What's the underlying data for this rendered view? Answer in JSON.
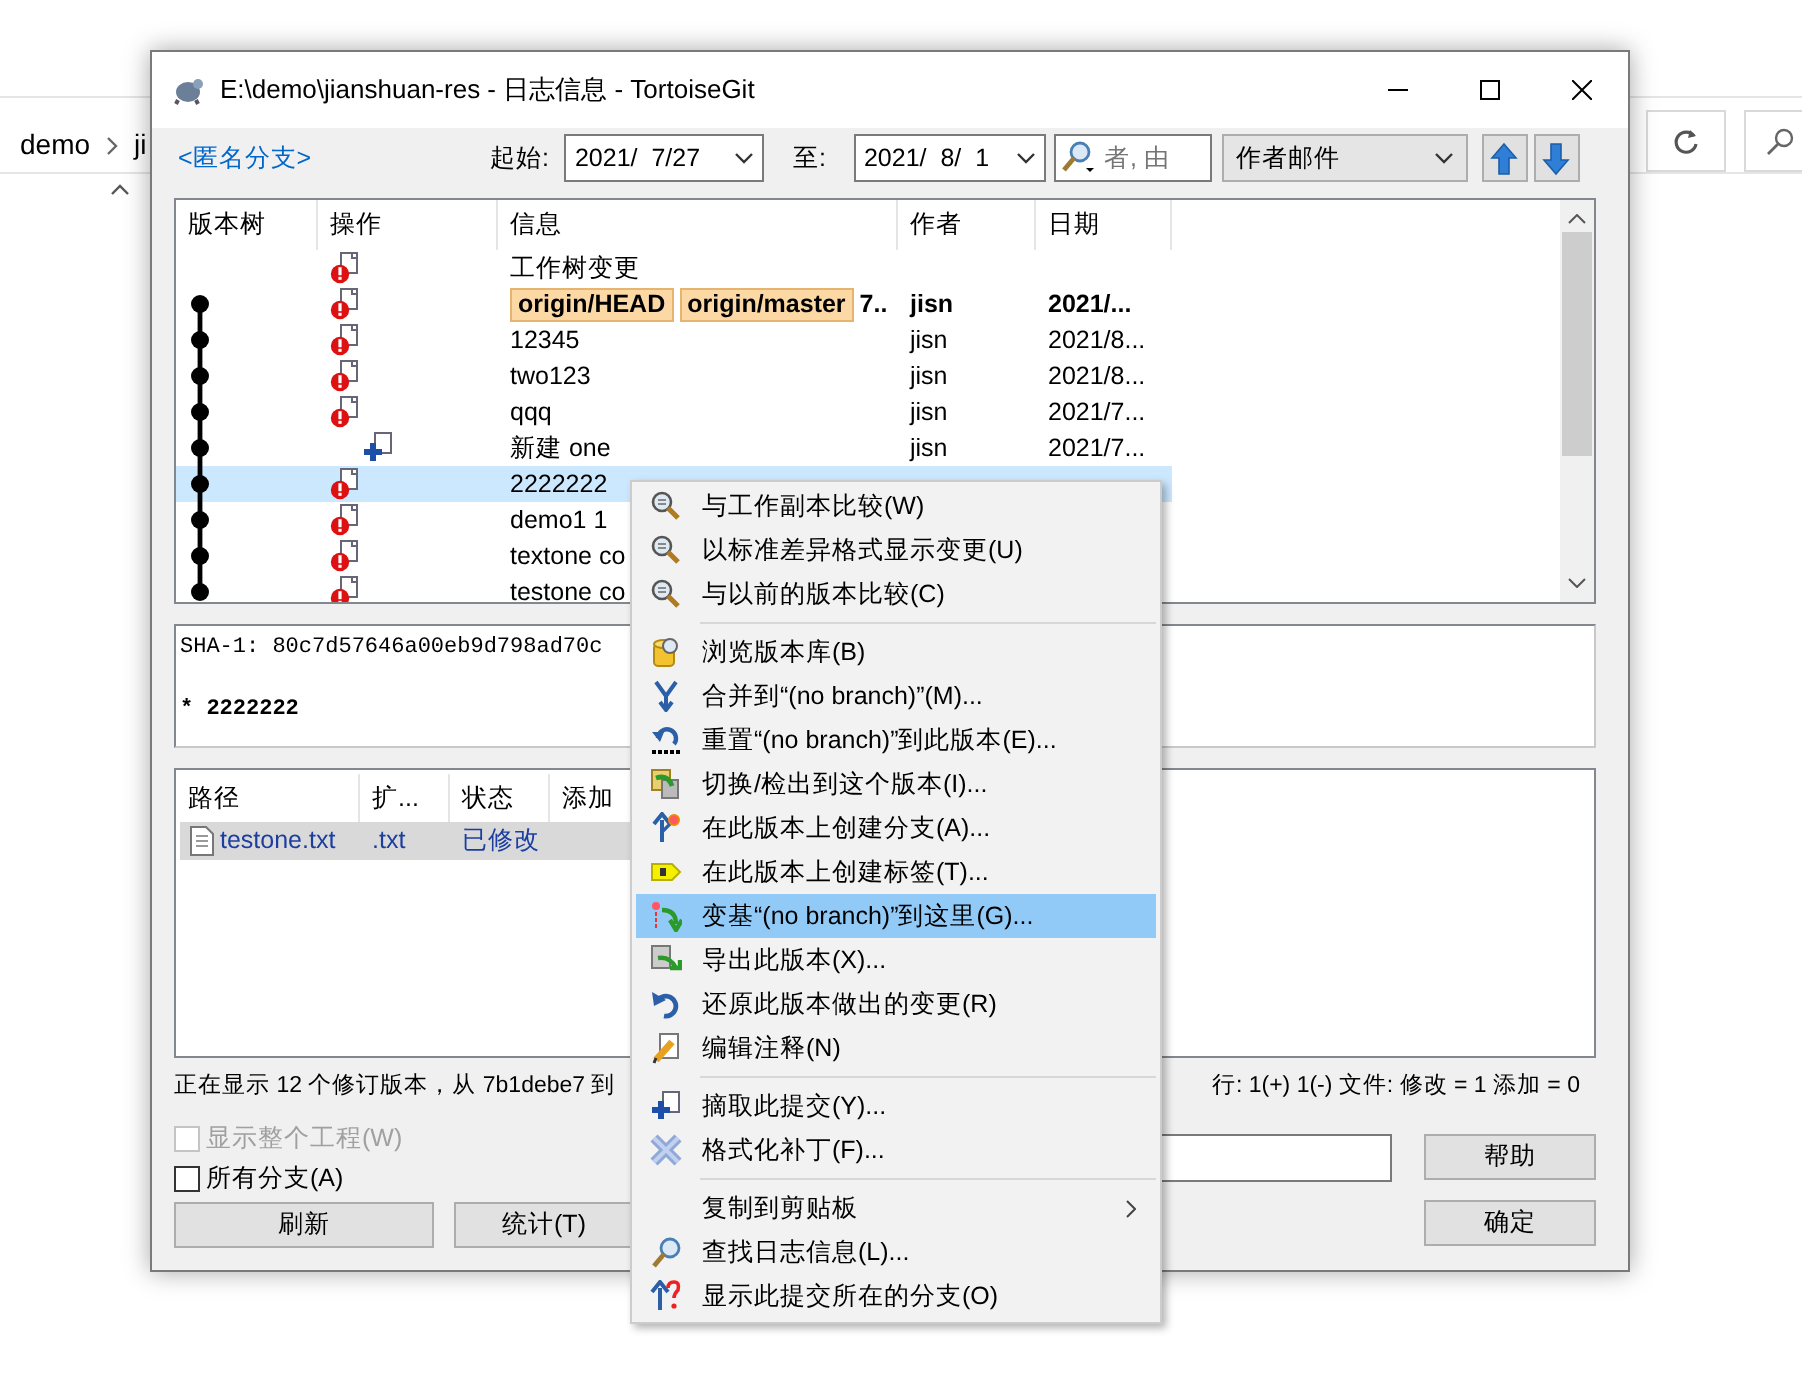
{
  "explorer": {
    "breadcrumb": [
      "demo",
      "ji"
    ]
  },
  "window": {
    "title": "E:\\demo\\jianshuan-res - 日志信息 - TortoiseGit"
  },
  "toolbar": {
    "branch_link": "<匿名分支>",
    "from_label": "起始:",
    "from_date": "2021/  7/27",
    "to_label": "至:",
    "to_date": "2021/  8/  1",
    "search": {
      "placeholder": "者, 由"
    },
    "filter_combo": "作者邮件"
  },
  "log": {
    "columns": [
      "版本树",
      "操作",
      "信息",
      "作者",
      "日期"
    ],
    "rows": [
      {
        "graph_node": false,
        "kind": "modified",
        "refs": [],
        "message": "工作树变更",
        "bold": false,
        "selected": false
      },
      {
        "graph_node": true,
        "kind": "modified",
        "refs": [
          "origin/HEAD",
          "origin/master"
        ],
        "message": "7..",
        "author": "jisn",
        "date": "2021/...",
        "bold": true,
        "selected": false
      },
      {
        "graph_node": true,
        "kind": "modified",
        "refs": [],
        "message": "12345",
        "author": "jisn",
        "date": "2021/8...",
        "bold": false,
        "selected": false
      },
      {
        "graph_node": true,
        "kind": "modified",
        "refs": [],
        "message": "two123",
        "author": "jisn",
        "date": "2021/8...",
        "bold": false,
        "selected": false
      },
      {
        "graph_node": true,
        "kind": "modified",
        "refs": [],
        "message": "qqq",
        "author": "jisn",
        "date": "2021/7...",
        "bold": false,
        "selected": false
      },
      {
        "graph_node": true,
        "kind": "added",
        "refs": [],
        "message": "新建 one",
        "author": "jisn",
        "date": "2021/7...",
        "bold": false,
        "selected": false
      },
      {
        "graph_node": true,
        "kind": "modified",
        "refs": [],
        "message": "2222222",
        "bold": false,
        "selected": true
      },
      {
        "graph_node": true,
        "kind": "modified",
        "refs": [],
        "message": "demo1  1",
        "bold": false,
        "selected": false
      },
      {
        "graph_node": true,
        "kind": "modified",
        "refs": [],
        "message": "textone co",
        "bold": false,
        "selected": false
      },
      {
        "graph_node": true,
        "kind": "modified",
        "refs": [],
        "message": "testone co",
        "bold": false,
        "selected": false
      }
    ]
  },
  "message_box": {
    "sha_line": "SHA-1: 80c7d57646a00eb9d798ad70c",
    "subject": "* 2222222"
  },
  "files": {
    "columns": [
      "路径",
      "扩...",
      "状态",
      "添加"
    ],
    "rows": [
      {
        "path": "testone.txt",
        "ext": ".txt",
        "status": "已修改",
        "selected": true
      }
    ]
  },
  "status": [
    "正在显示 12 个修订版本，从 7b1debe7 到",
    "行: 1(+) 1(-) 文件: 修改 = 1 添加 = 0"
  ],
  "checkboxes": [
    {
      "label": "显示整个工程(W)",
      "checked": false,
      "disabled": true
    },
    {
      "label": "所有分支(A)",
      "checked": false,
      "disabled": false
    }
  ],
  "buttons": {
    "refresh": "刷新",
    "statistics": "统计(T)",
    "help": "帮助",
    "ok": "确定"
  },
  "context_menu": {
    "groups": [
      [
        {
          "label": "与工作副本比较(W)",
          "selected": false
        },
        {
          "label": "以标准差异格式显示变更(U)",
          "selected": false
        },
        {
          "label": "与以前的版本比较(C)",
          "selected": false
        }
      ],
      [
        {
          "label": "浏览版本库(B)",
          "selected": false
        },
        {
          "label": "合并到“(no branch)”(M)...",
          "selected": false
        },
        {
          "label": "重置“(no branch)”到此版本(E)...",
          "selected": false
        },
        {
          "label": "切换/检出到这个版本(I)...",
          "selected": false
        },
        {
          "label": "在此版本上创建分支(A)...",
          "selected": false
        },
        {
          "label": "在此版本上创建标签(T)...",
          "selected": false
        },
        {
          "label": "变基“(no branch)”到这里(G)...",
          "selected": true
        },
        {
          "label": "导出此版本(X)...",
          "selected": false
        },
        {
          "label": "还原此版本做出的变更(R)",
          "selected": false
        },
        {
          "label": "编辑注释(N)",
          "selected": false
        }
      ],
      [
        {
          "label": "摘取此提交(Y)...",
          "selected": false
        },
        {
          "label": "格式化补丁(F)...",
          "selected": false
        }
      ],
      [
        {
          "label": "复制到剪贴板",
          "selected": false,
          "submenu": true
        },
        {
          "label": "查找日志信息(L)...",
          "selected": false
        },
        {
          "label": "显示此提交所在的分支(O)",
          "selected": false
        }
      ]
    ]
  }
}
